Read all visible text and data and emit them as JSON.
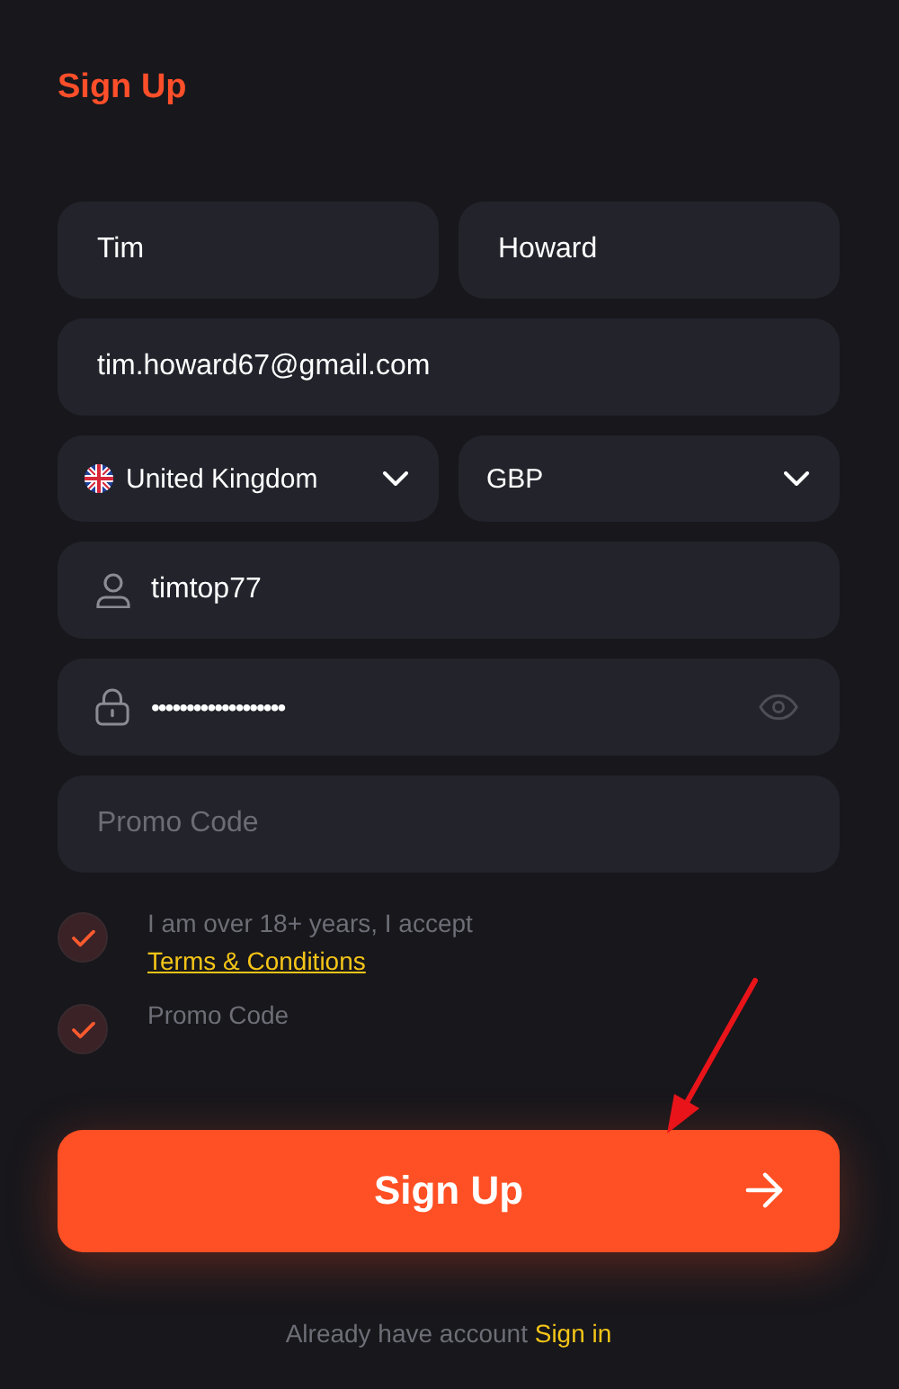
{
  "title": "Sign Up",
  "name_fields": [
    {
      "value": "Tim"
    },
    {
      "value": "Howard"
    }
  ],
  "email": {
    "value": "tim.howard67@gmail.com"
  },
  "selects": [
    {
      "kind": "country",
      "value": "United Kingdom"
    },
    {
      "kind": "currency",
      "value": "GBP"
    }
  ],
  "username": {
    "value": "timtop77"
  },
  "password": {
    "value": "•••••••••••••••••••"
  },
  "promo": {
    "placeholder": "Promo Code"
  },
  "checkboxes": [
    {
      "text": "I am over 18+ years, I accept",
      "link": "Terms & Conditions",
      "checked": true
    },
    {
      "text": "Promo Code",
      "checked": true
    }
  ],
  "submit": {
    "label": "Sign Up"
  },
  "footer": {
    "text": "Already have account",
    "link": "Sign in"
  }
}
